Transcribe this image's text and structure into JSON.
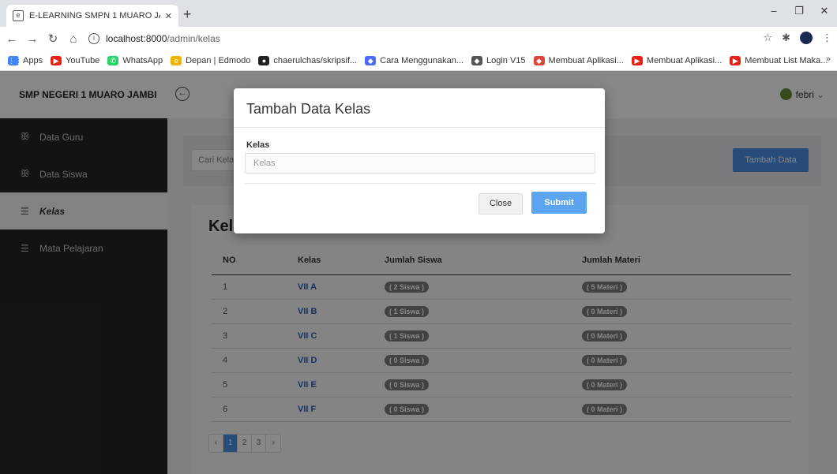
{
  "browser": {
    "tab_title": "E-LEARNING SMPN 1 MUARO JA",
    "tab_close": "✕",
    "new_tab": "+",
    "url_host": "localhost:8000",
    "url_path": "/admin/kelas",
    "bookmarks": [
      {
        "label": "Apps",
        "icon": "apps-grid-icon",
        "color": "#4285f4"
      },
      {
        "label": "YouTube",
        "icon": "youtube-icon",
        "color": "#e62117"
      },
      {
        "label": "WhatsApp",
        "icon": "whatsapp-icon",
        "color": "#25d366"
      },
      {
        "label": "Depan | Edmodo",
        "icon": "edmodo-icon",
        "color": "#f2b400"
      },
      {
        "label": "chaerulchas/skripsif...",
        "icon": "github-icon",
        "color": "#222222"
      },
      {
        "label": "Cara Menggunakan...",
        "icon": "bookmark-icon",
        "color": "#4a6cf7"
      },
      {
        "label": "Login V15",
        "icon": "bookmark-icon",
        "color": "#555555"
      },
      {
        "label": "Membuat Aplikasi...",
        "icon": "bookmark-icon",
        "color": "#e0453a"
      },
      {
        "label": "Membuat Aplikasi...",
        "icon": "youtube-icon",
        "color": "#e62117"
      },
      {
        "label": "Membuat List Maka...",
        "icon": "youtube-icon",
        "color": "#e62117"
      }
    ],
    "bookmarks_more": "»"
  },
  "header": {
    "brand": "SMP NEGERI 1 MUARO JAMBI",
    "user_name": "febri"
  },
  "sidebar": {
    "items": [
      {
        "label": "Data Guru",
        "icon": "users-icon",
        "active": false
      },
      {
        "label": "Data Siswa",
        "icon": "users-icon",
        "active": false
      },
      {
        "label": "Kelas",
        "icon": "database-icon",
        "active": true
      },
      {
        "label": "Mata Pelajaran",
        "icon": "database-icon",
        "active": false
      }
    ]
  },
  "toolbar": {
    "search_placeholder": "Cari Kelas",
    "add_label": "Tambah Data"
  },
  "table": {
    "title": "Kelas",
    "columns": [
      "NO",
      "Kelas",
      "Jumlah Siswa",
      "Jumlah Materi"
    ],
    "rows": [
      {
        "no": "1",
        "kelas": "VII A",
        "siswa": "( 2 Siswa )",
        "materi": "( 5 Materi )"
      },
      {
        "no": "2",
        "kelas": "VII B",
        "siswa": "( 1 Siswa )",
        "materi": "( 0 Materi )"
      },
      {
        "no": "3",
        "kelas": "VII C",
        "siswa": "( 1 Siswa )",
        "materi": "( 0 Materi )"
      },
      {
        "no": "4",
        "kelas": "VII D",
        "siswa": "( 0 Siswa )",
        "materi": "( 0 Materi )"
      },
      {
        "no": "5",
        "kelas": "VII E",
        "siswa": "( 0 Siswa )",
        "materi": "( 0 Materi )"
      },
      {
        "no": "6",
        "kelas": "VII F",
        "siswa": "( 0 Siswa )",
        "materi": "( 0 Materi )"
      }
    ]
  },
  "pagination": {
    "prev": "‹",
    "pages": [
      "1",
      "2",
      "3"
    ],
    "current": "1",
    "next": "›"
  },
  "modal": {
    "title": "Tambah Data Kelas",
    "field_label": "Kelas",
    "field_placeholder": "Kelas",
    "close_label": "Close",
    "submit_label": "Submit"
  },
  "colors": {
    "primary": "#4b90e6",
    "sidebar_bg": "#222529",
    "badge": "#7e7e7e",
    "link": "#2b5fb3"
  }
}
